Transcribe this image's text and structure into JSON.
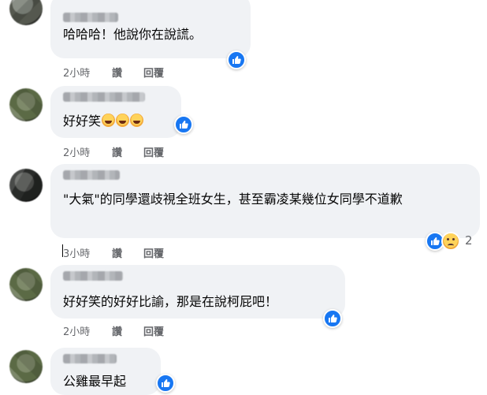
{
  "comments": [
    {
      "text": "哈哈哈！他說你在說謊。",
      "time": "2小時",
      "action_like": "讚",
      "action_reply": "回覆"
    },
    {
      "text": "好好笑",
      "time": "2小時",
      "action_like": "讚",
      "action_reply": "回覆"
    },
    {
      "text": "\"大氣\"的同學還歧視全班女生，甚至霸凌某幾位女同學不道歉",
      "time": "3小時",
      "action_like": "讚",
      "action_reply": "回覆",
      "reaction_count": "2"
    },
    {
      "text": "好好笑的好好比諭，那是在說柯屁吧！",
      "time": "2小時",
      "action_like": "讚",
      "action_reply": "回覆"
    },
    {
      "text": "公雞最早起"
    }
  ],
  "colors": {
    "bubble": "#f0f2f5",
    "like_blue": "#1877f2",
    "meta_gray": "#65676b"
  },
  "icons": [
    "like-icon",
    "sad-icon",
    "rofl-emoji"
  ]
}
